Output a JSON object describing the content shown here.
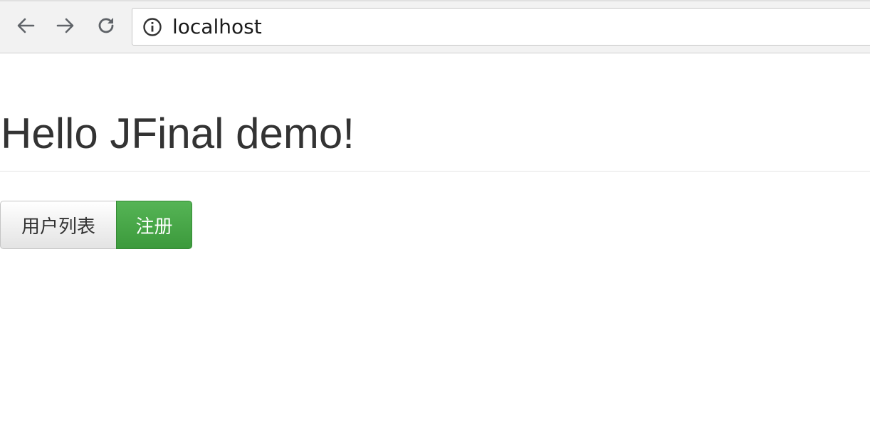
{
  "browser": {
    "url": "localhost",
    "icons": {
      "back": "arrow-left-icon",
      "forward": "arrow-right-icon",
      "reload": "reload-icon",
      "info": "info-icon"
    }
  },
  "page": {
    "title": "Hello JFinal demo!",
    "buttons": {
      "user_list": "用户列表",
      "register": "注册"
    }
  },
  "colors": {
    "success": "#449d44",
    "title_text": "#333333"
  }
}
